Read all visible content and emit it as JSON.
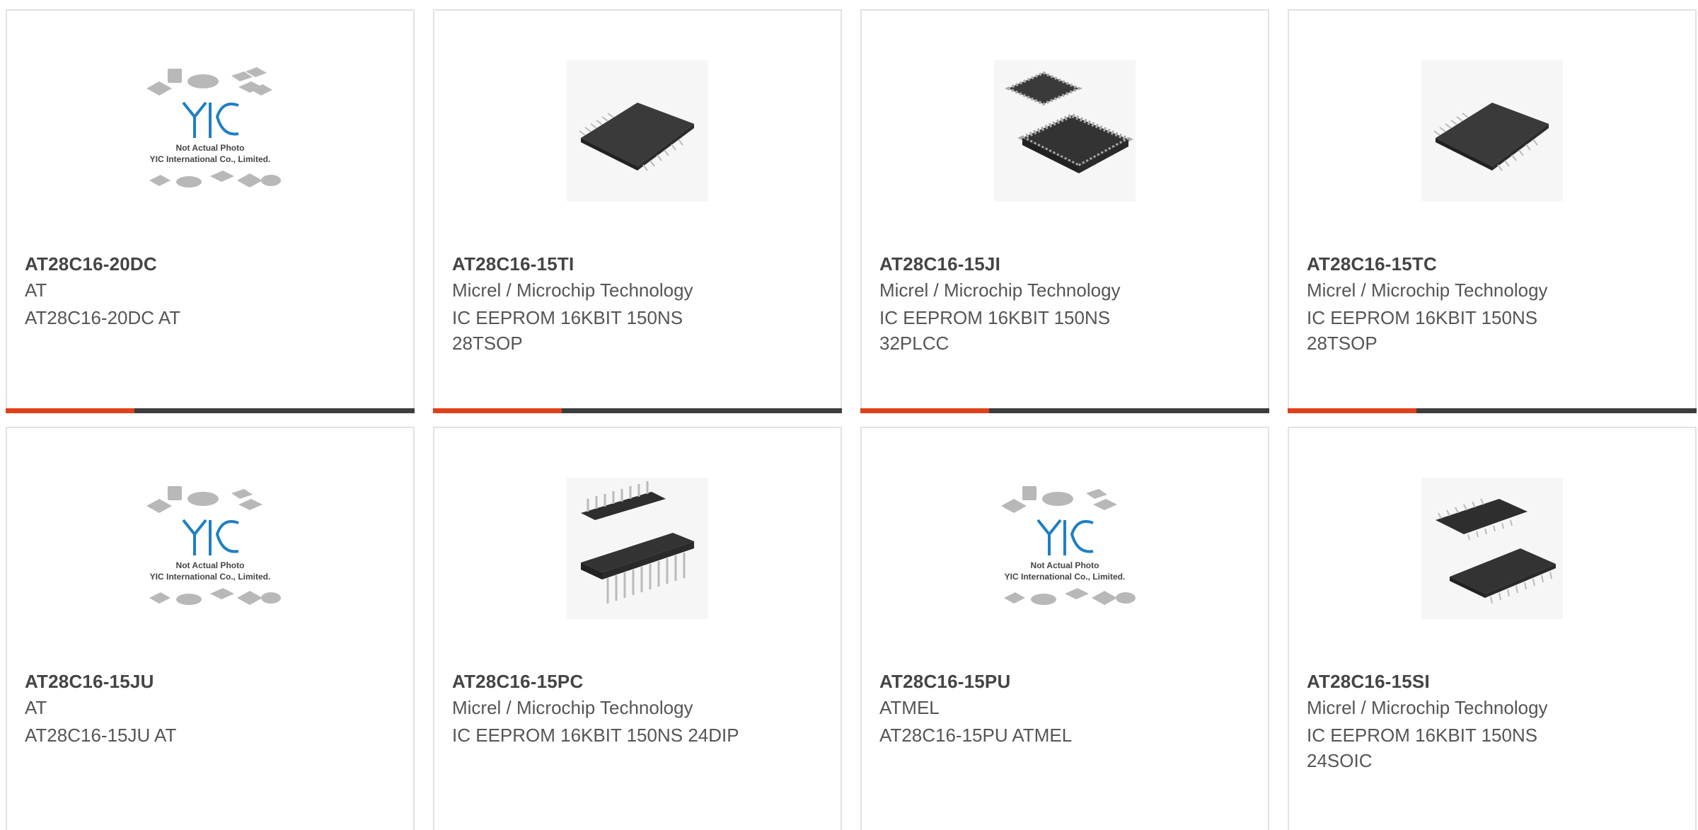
{
  "products": [
    {
      "part_number": "AT28C16-20DC",
      "manufacturer": "AT",
      "description": "AT28C16-20DC AT",
      "image": "placeholder",
      "placeholder_line1": "Not Actual Photo",
      "placeholder_line2": "YIC International Co., Limited.",
      "placeholder_logo": "YIC"
    },
    {
      "part_number": "AT28C16-15TI",
      "manufacturer": "Micrel / Microchip Technology",
      "description": "IC EEPROM 16KBIT 150NS 28TSOP",
      "image": "tsop-chip"
    },
    {
      "part_number": "AT28C16-15JI",
      "manufacturer": "Micrel / Microchip Technology",
      "description": "IC EEPROM 16KBIT 150NS 32PLCC",
      "image": "plcc-chip"
    },
    {
      "part_number": "AT28C16-15TC",
      "manufacturer": "Micrel / Microchip Technology",
      "description": "IC EEPROM 16KBIT 150NS 28TSOP",
      "image": "tsop-chip"
    },
    {
      "part_number": "AT28C16-15JU",
      "manufacturer": "AT",
      "description": "AT28C16-15JU AT",
      "image": "placeholder",
      "placeholder_line1": "Not Actual Photo",
      "placeholder_line2": "YIC International Co., Limited.",
      "placeholder_logo": "YIC"
    },
    {
      "part_number": "AT28C16-15PC",
      "manufacturer": "Micrel / Microchip Technology",
      "description": "IC EEPROM 16KBIT 150NS 24DIP",
      "image": "dip-chip"
    },
    {
      "part_number": "AT28C16-15PU",
      "manufacturer": "ATMEL",
      "description": "AT28C16-15PU ATMEL",
      "image": "placeholder",
      "placeholder_line1": "Not Actual Photo",
      "placeholder_line2": "YIC International Co., Limited.",
      "placeholder_logo": "YIC"
    },
    {
      "part_number": "AT28C16-15SI",
      "manufacturer": "Micrel / Microchip Technology",
      "description": "IC EEPROM 16KBIT 150NS 24SOIC",
      "image": "soic-chip"
    }
  ],
  "colors": {
    "accent": "#e0401a",
    "bar": "#3d3d3d",
    "logo_blue": "#1f7fc2",
    "border": "#e2e2e2"
  }
}
